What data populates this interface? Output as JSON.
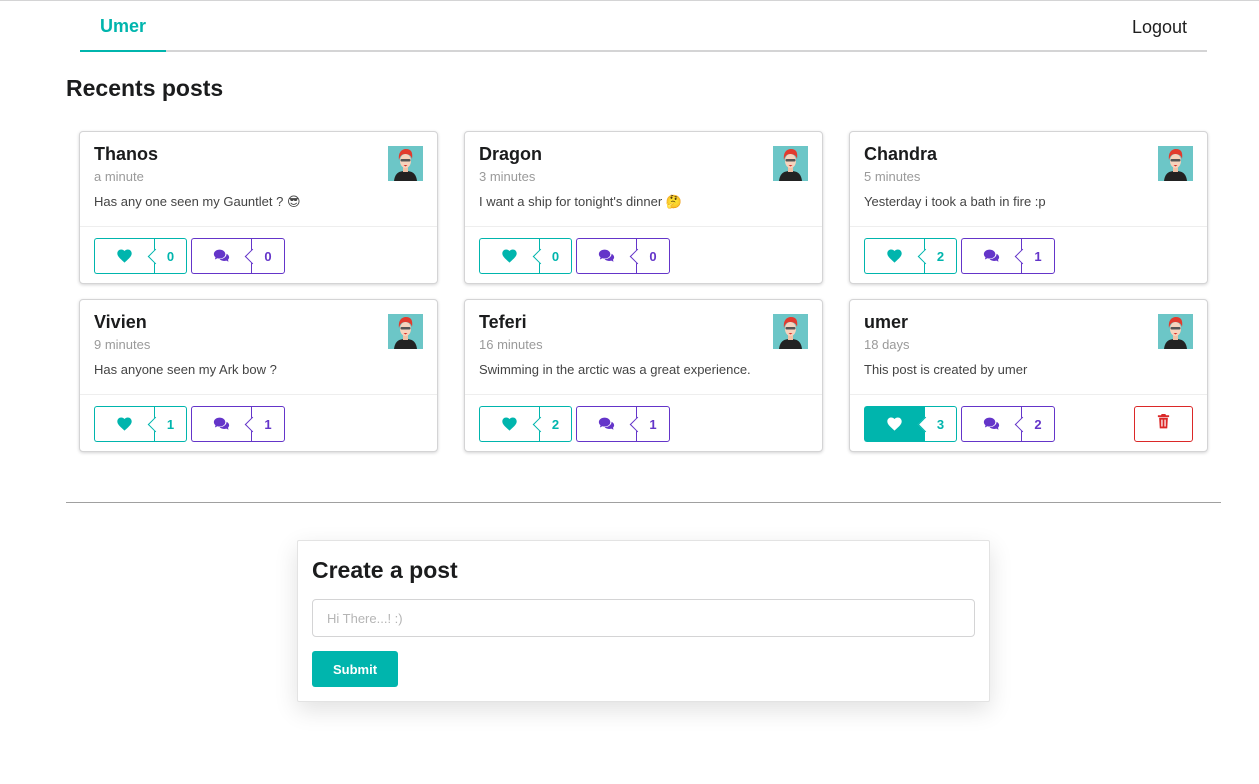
{
  "nav": {
    "brand": "Umer",
    "logout": "Logout"
  },
  "page_title": "Recents posts",
  "posts": [
    {
      "author": "Thanos",
      "time": "a minute",
      "text": "Has any one seen my Gauntlet ? 😎",
      "likes": "0",
      "comments": "0",
      "liked": false,
      "deletable": false
    },
    {
      "author": "Dragon",
      "time": "3 minutes",
      "text": "I want a ship for tonight's dinner 🤔",
      "likes": "0",
      "comments": "0",
      "liked": false,
      "deletable": false
    },
    {
      "author": "Chandra",
      "time": "5 minutes",
      "text": "Yesterday i took a bath in fire :p",
      "likes": "2",
      "comments": "1",
      "liked": false,
      "deletable": false
    },
    {
      "author": "Vivien",
      "time": "9 minutes",
      "text": "Has anyone seen my Ark bow ?",
      "likes": "1",
      "comments": "1",
      "liked": false,
      "deletable": false
    },
    {
      "author": "Teferi",
      "time": "16 minutes",
      "text": "Swimming in the arctic was a great experience.",
      "likes": "2",
      "comments": "1",
      "liked": false,
      "deletable": false
    },
    {
      "author": "umer",
      "time": "18 days",
      "text": "This post is created by umer",
      "likes": "3",
      "comments": "2",
      "liked": true,
      "deletable": true
    }
  ],
  "create": {
    "title": "Create a post",
    "placeholder": "Hi There...! :)",
    "value": "",
    "submit_label": "Submit"
  },
  "colors": {
    "teal": "#00b5ad",
    "violet": "#6435c9",
    "red": "#db2828"
  },
  "icons": {
    "like": "heart-icon",
    "comment": "comments-icon",
    "delete": "trash-icon"
  }
}
